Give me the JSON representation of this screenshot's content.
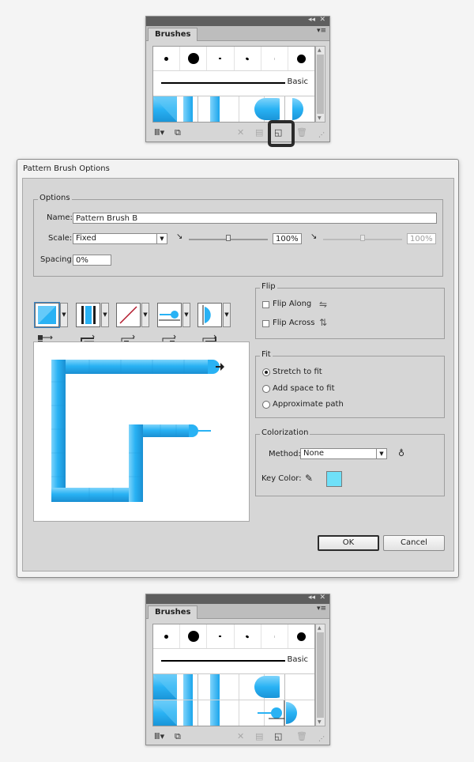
{
  "brushes_panel_top": {
    "tab_label": "Brushes",
    "basic_label": "Basic"
  },
  "dialog": {
    "title": "Pattern Brush Options",
    "options_legend": "Options",
    "name_label": "Name:",
    "name_value": "Pattern Brush B",
    "scale_label": "Scale:",
    "scale_value": "Fixed",
    "scale_percent": "100%",
    "scale_percent_2": "100%",
    "spacing_label": "Spacing:",
    "spacing_value": "0%",
    "flip_legend": "Flip",
    "flip_along_label": "Flip Along",
    "flip_across_label": "Flip Across",
    "fit_legend": "Fit",
    "fit_options": [
      "Stretch to fit",
      "Add space to fit",
      "Approximate path"
    ],
    "fit_selected": "Stretch to fit",
    "colorization_legend": "Colorization",
    "method_label": "Method:",
    "method_value": "None",
    "key_color_label": "Key Color:",
    "key_color": "#6fe0f8",
    "ok_label": "OK",
    "cancel_label": "Cancel"
  },
  "brushes_panel_bottom": {
    "tab_label": "Brushes",
    "basic_label": "Basic"
  },
  "colors": {
    "pattern_blue": "#29b2f4",
    "pattern_blue_light": "#7fd4fb"
  }
}
